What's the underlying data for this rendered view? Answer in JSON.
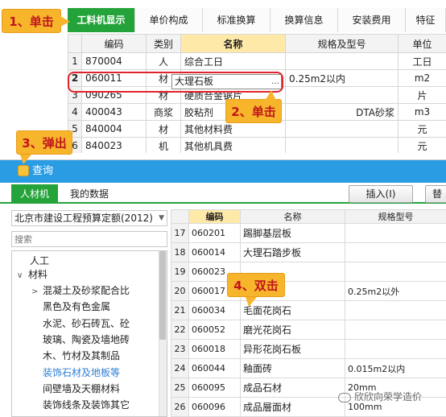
{
  "top": {
    "tabs": [
      "工料机显示",
      "单价构成",
      "标准换算",
      "换算信息",
      "安装费用",
      "特征"
    ],
    "columns": [
      "",
      "编码",
      "类别",
      "名称",
      "规格及型号",
      "单位"
    ],
    "rows": [
      {
        "n": "1",
        "code": "870004",
        "type": "人",
        "name": "综合工日",
        "spec": "",
        "unit": "工日"
      },
      {
        "n": "2",
        "code": "060011",
        "type": "材",
        "name": "大理石板",
        "spec": "0.25m2以内",
        "unit": "m2"
      },
      {
        "n": "3",
        "code": "090265",
        "type": "材",
        "name": "硬质合金锯片",
        "spec": "",
        "unit": "片"
      },
      {
        "n": "4",
        "code": "400043",
        "type": "商浆",
        "name": "胶粘剂",
        "spec": "DTA砂浆",
        "unit": "m3"
      },
      {
        "n": "5",
        "code": "840004",
        "type": "材",
        "name": "其他材料费",
        "spec": "",
        "unit": "元"
      },
      {
        "n": "6",
        "code": "840023",
        "type": "机",
        "name": "其他机具费",
        "spec": "",
        "unit": "元"
      }
    ]
  },
  "callouts": {
    "c1": "1、单击",
    "c2": "2、单击",
    "c3": "3、弹出",
    "c4": "4、双击"
  },
  "dialog": {
    "title": "查询",
    "tabs": [
      "人材机",
      "我的数据"
    ],
    "insert_label": "插入(I)",
    "replace_label": "替",
    "library": "北京市建设工程预算定额(2012)",
    "search_placeholder": "搜索",
    "tree": [
      {
        "label": "人工",
        "level": 1,
        "arrow": "",
        "link": false
      },
      {
        "label": "材料",
        "level": 0,
        "arrow": "∨",
        "link": false
      },
      {
        "label": "混凝土及砂浆配合比",
        "level": 2,
        "arrow": ">",
        "link": false
      },
      {
        "label": "黑色及有色金属",
        "level": 2,
        "arrow": "",
        "link": false
      },
      {
        "label": "水泥、砂石砖瓦、砼",
        "level": 2,
        "arrow": "",
        "link": false
      },
      {
        "label": "玻璃、陶瓷及墙地砖",
        "level": 2,
        "arrow": "",
        "link": false
      },
      {
        "label": "木、竹材及其制品",
        "level": 2,
        "arrow": "",
        "link": false
      },
      {
        "label": "装饰石材及地板等",
        "level": 2,
        "arrow": "",
        "link": true
      },
      {
        "label": "间壁墙及天棚材料",
        "level": 2,
        "arrow": "",
        "link": false
      },
      {
        "label": "装饰线条及装饰其它",
        "level": 2,
        "arrow": "",
        "link": false
      }
    ],
    "columns": [
      "",
      "编码",
      "名称",
      "规格型号"
    ],
    "rows": [
      {
        "n": "17",
        "code": "060201",
        "name": "踢脚基层板",
        "spec": ""
      },
      {
        "n": "18",
        "code": "060014",
        "name": "大理石踏步板",
        "spec": ""
      },
      {
        "n": "19",
        "code": "060023",
        "name": "",
        "spec": ""
      },
      {
        "n": "20",
        "code": "060017",
        "name": "",
        "spec": "0.25m2以外"
      },
      {
        "n": "21",
        "code": "060034",
        "name": "毛面花岗石",
        "spec": ""
      },
      {
        "n": "22",
        "code": "060052",
        "name": "磨光花岗石",
        "spec": ""
      },
      {
        "n": "23",
        "code": "060018",
        "name": "异形花岗石板",
        "spec": ""
      },
      {
        "n": "24",
        "code": "060044",
        "name": "釉面砖",
        "spec": "0.015m2以内"
      },
      {
        "n": "25",
        "code": "060095",
        "name": "成品石材",
        "spec": "20mm"
      },
      {
        "n": "26",
        "code": "060096",
        "name": "成品層面材",
        "spec": "100mm"
      }
    ]
  },
  "watermark": "欣欣向荣学造价"
}
